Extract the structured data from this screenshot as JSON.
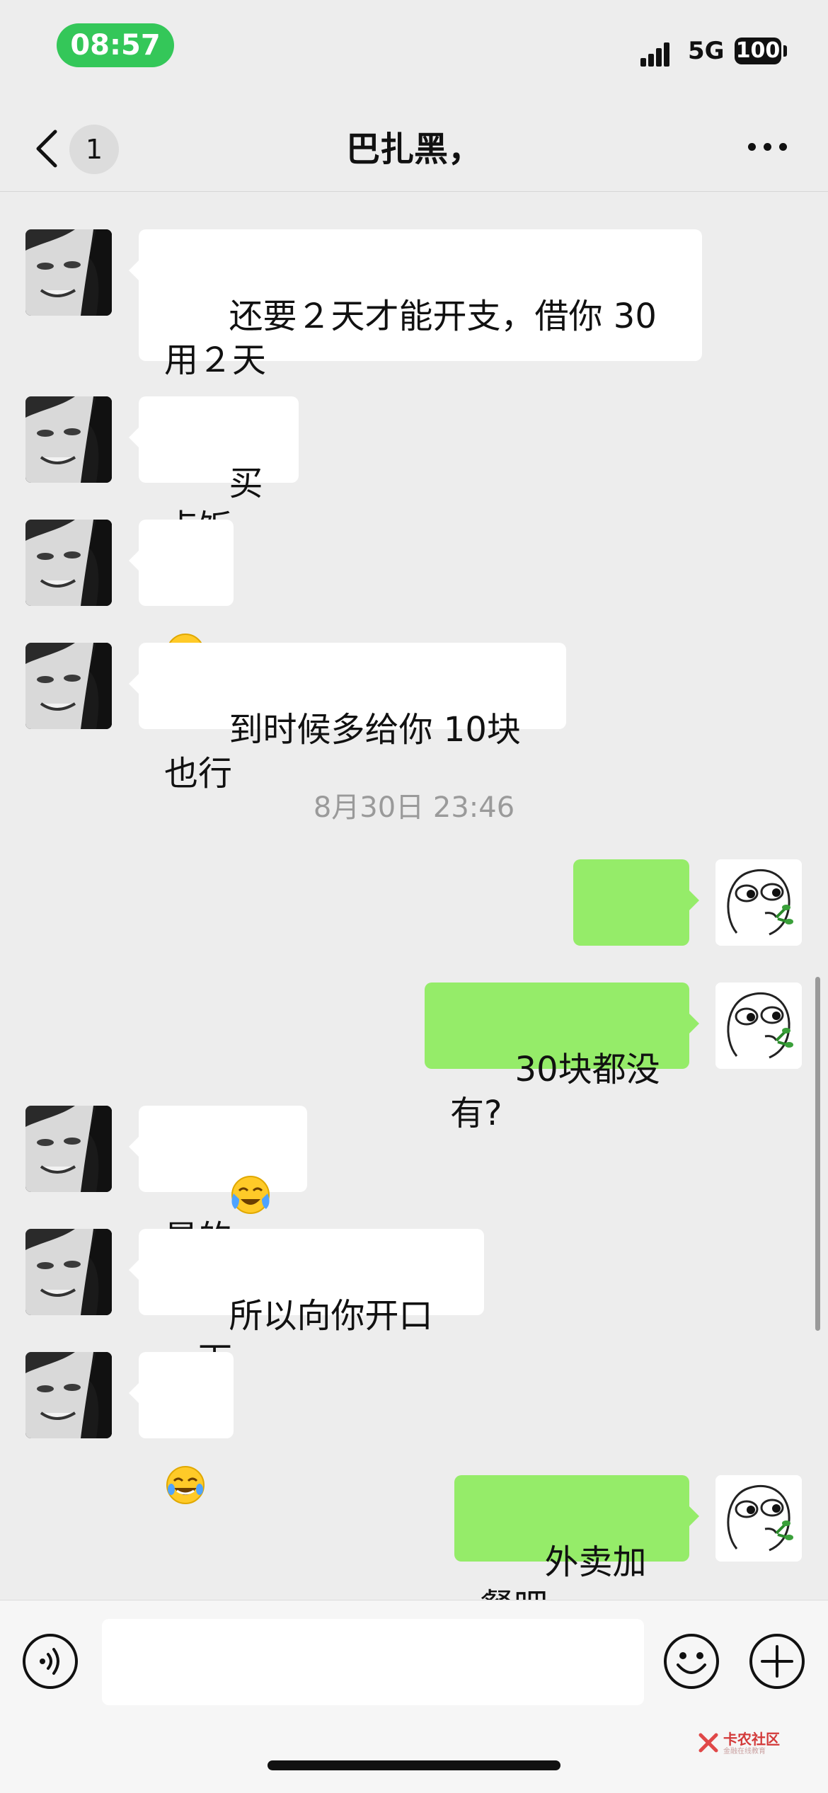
{
  "status_bar": {
    "time": "08:57",
    "network": "5G",
    "battery": "100"
  },
  "header": {
    "title": "巴扎黑，",
    "unread_count": "1"
  },
  "messages": [
    {
      "text": "还要２天才能开支，借你 30用２天"
    },
    {
      "text": "买点饭"
    },
    {
      "text": "到时候多给你 10块也行"
    },
    {
      "text": "。。。"
    },
    {
      "text": "30块都没有?"
    },
    {
      "text": "是的"
    },
    {
      "text": "所以向你开口一下"
    },
    {
      "text": "外卖加餐吧"
    }
  ],
  "emojis": [
    "cry-laugh-emoji",
    "cry-laugh-emoji",
    "laugh-emoji"
  ],
  "timestamp": "8月30日 23:46",
  "input_bar": {
    "placeholder": ""
  },
  "watermark": {
    "title": "卡农社区",
    "subtitle": "金融在线教育"
  },
  "colors": {
    "incoming_bubble": "#ffffff",
    "outgoing_bubble": "#95ec69",
    "background": "#ededed",
    "time_pill": "#34c759"
  }
}
